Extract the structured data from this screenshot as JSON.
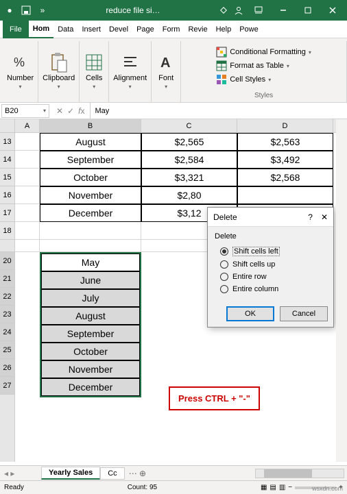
{
  "titlebar": {
    "title": "reduce file si…"
  },
  "tabs": {
    "file": "File",
    "home": "Hom",
    "data": "Data",
    "insert": "Insert",
    "devel": "Devel",
    "page": "Page",
    "form": "Form",
    "revie": "Revie",
    "help": "Help",
    "powe": "Powe"
  },
  "ribbon": {
    "number_label": "Number",
    "clipboard_label": "Clipboard",
    "cells_label": "Cells",
    "alignment_label": "Alignment",
    "font_label": "Font",
    "styles_label": "Styles",
    "cond_fmt": "Conditional Formatting",
    "fmt_table": "Format as Table",
    "cell_styles": "Cell Styles"
  },
  "namebox": "B20",
  "formula": "May",
  "cols": {
    "a": "A",
    "b": "B",
    "c": "C",
    "d": "D"
  },
  "rows": [
    "13",
    "14",
    "15",
    "16",
    "17",
    "18",
    "",
    "20",
    "21",
    "22",
    "23",
    "24",
    "25",
    "26",
    "27"
  ],
  "table": [
    {
      "b": "August",
      "c": "$2,565",
      "d": "$2,563"
    },
    {
      "b": "September",
      "c": "$2,584",
      "d": "$3,492"
    },
    {
      "b": "October",
      "c": "$3,321",
      "d": "$2,568"
    },
    {
      "b": "November",
      "c": "$2,80",
      "d": ""
    },
    {
      "b": "December",
      "c": "$3,12",
      "d": ""
    }
  ],
  "selection": [
    "May",
    "June",
    "July",
    "August",
    "September",
    "October",
    "November",
    "December"
  ],
  "dialog": {
    "title": "Delete",
    "group": "Delete",
    "opt1": "Shift cells left",
    "opt1_underline": "l",
    "opt2": "Shift cells up",
    "opt2_underline": "u",
    "opt3": "Entire row",
    "opt3_underline": "r",
    "opt4": "Entire column",
    "opt4_underline": "c",
    "ok": "OK",
    "cancel": "Cancel"
  },
  "callout": "Press CTRL + \"-\"",
  "sheets": {
    "active": "Yearly Sales",
    "next": "Cc"
  },
  "status": {
    "ready": "Ready",
    "count": "Count: 95"
  },
  "watermark": "wsxdn.com"
}
